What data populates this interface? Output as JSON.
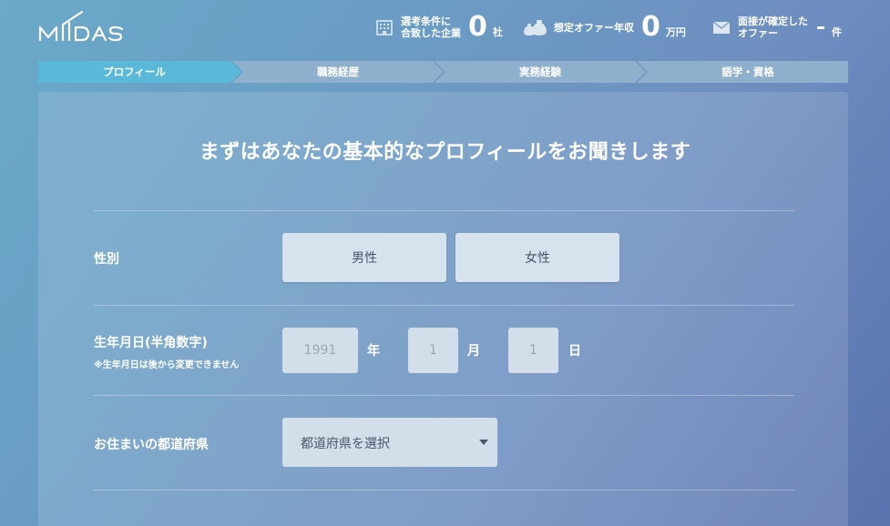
{
  "header": {
    "logo_text": "MIIDAS",
    "stats": [
      {
        "icon": "building-icon",
        "label_line1": "選考条件に",
        "label_line2": "合致した企業",
        "value": "0",
        "unit": "社"
      },
      {
        "icon": "money-bag-icon",
        "label_line1": "想定オファー年収",
        "label_line2": "",
        "value": "0",
        "unit": "万円"
      },
      {
        "icon": "envelope-icon",
        "label_line1": "面接が確定した",
        "label_line2": "オファー",
        "value": "-",
        "unit": "件"
      }
    ]
  },
  "steps": [
    {
      "label": "プロフィール",
      "active": true
    },
    {
      "label": "職務経歴",
      "active": false
    },
    {
      "label": "実務経験",
      "active": false
    },
    {
      "label": "語学・資格",
      "active": false
    }
  ],
  "form": {
    "title": "まずはあなたの基本的なプロフィールをお聞きします",
    "gender": {
      "label": "性別",
      "options": [
        "男性",
        "女性"
      ]
    },
    "birthdate": {
      "label": "生年月日(半角数字)",
      "note": "※生年月日は後から変更できません",
      "year_placeholder": "1991",
      "year_unit": "年",
      "month_placeholder": "1",
      "month_unit": "月",
      "day_placeholder": "1",
      "day_unit": "日"
    },
    "prefecture": {
      "label": "お住まいの都道府県",
      "placeholder": "都道府県を選択"
    }
  },
  "colors": {
    "step_active": "#5ab8d9",
    "step_inactive": "#8fb0cc",
    "button_bg": "#d6e2ee"
  }
}
